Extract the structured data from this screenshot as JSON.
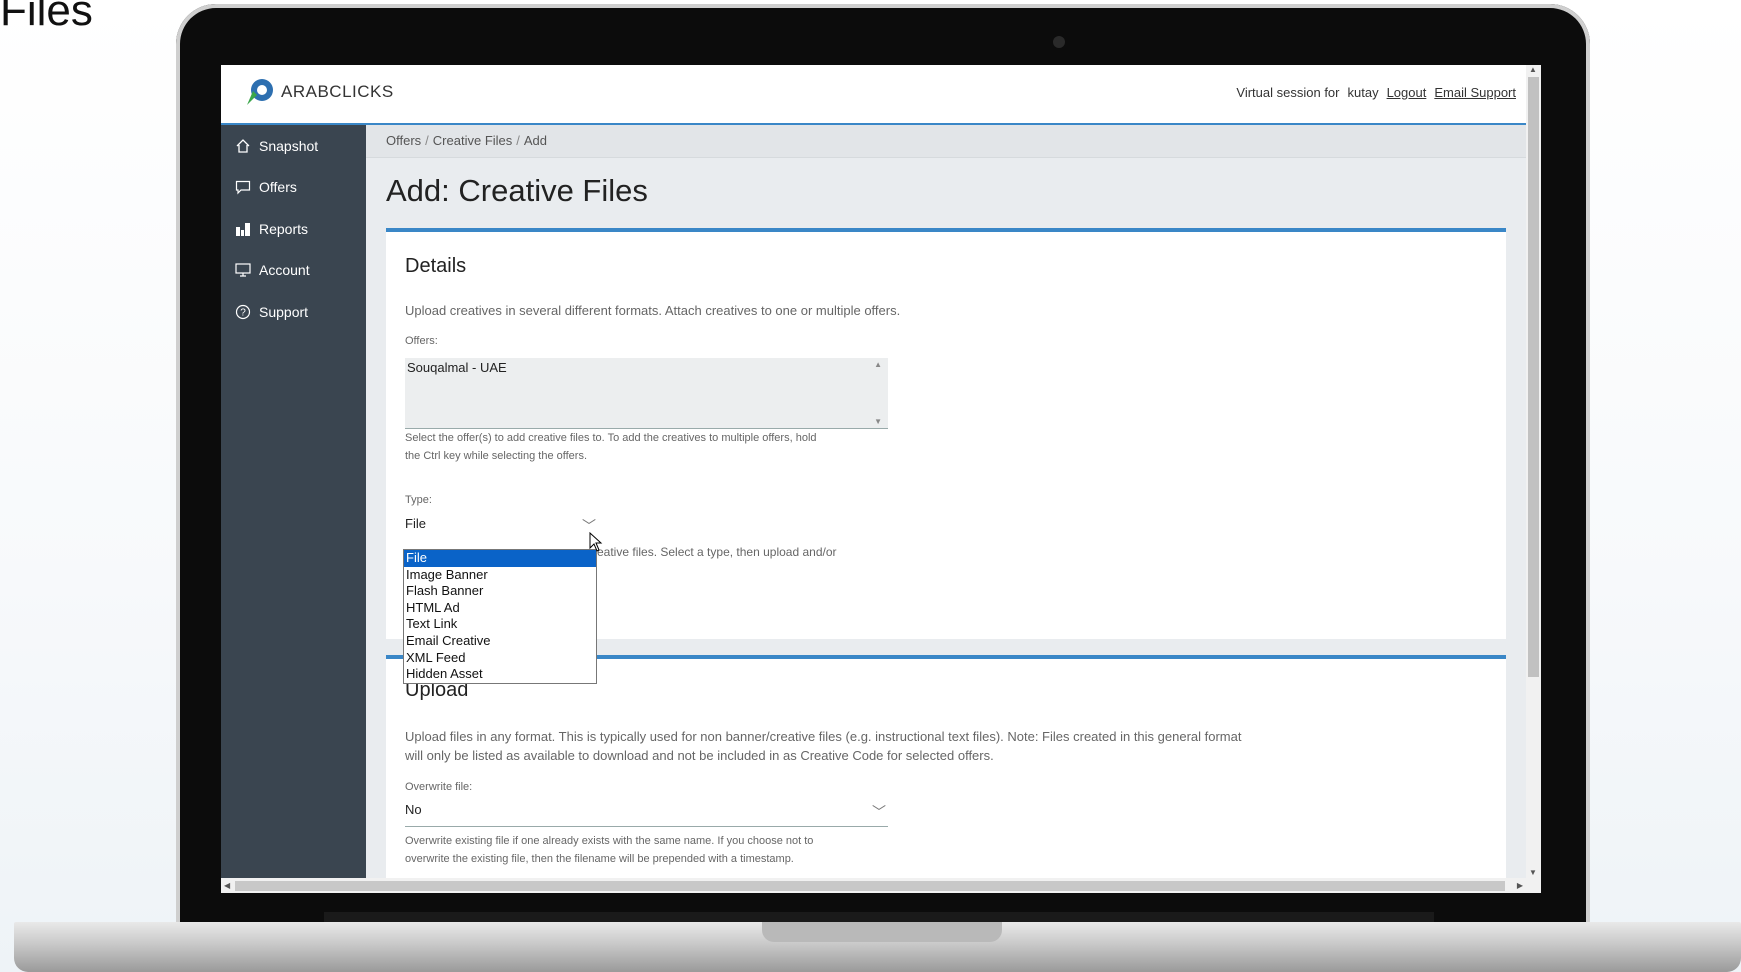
{
  "slide": {
    "title": "Files"
  },
  "app": {
    "logo_text": "ARABCLICKS",
    "header": {
      "session_label": "Virtual session for",
      "user": "kutay",
      "logout": "Logout",
      "email_support": "Email Support"
    },
    "sidebar": {
      "items": [
        {
          "label": "Snapshot",
          "icon": "home-icon"
        },
        {
          "label": "Offers",
          "icon": "chat-bubble-icon"
        },
        {
          "label": "Reports",
          "icon": "bar-chart-icon"
        },
        {
          "label": "Account",
          "icon": "monitor-icon"
        },
        {
          "label": "Support",
          "icon": "question-circle-icon"
        }
      ]
    },
    "breadcrumb": [
      "Offers",
      "Creative Files",
      "Add"
    ],
    "page_title": "Add: Creative Files",
    "details": {
      "heading": "Details",
      "description": "Upload creatives in several different formats. Attach creatives to one or multiple offers.",
      "offers_label": "Offers:",
      "offers_selected": "Souqalmal - UAE",
      "offers_help_1": "Select the offer(s) to add creative files to. To add the creatives to multiple offers, hold",
      "offers_help_2": "the Ctrl key while selecting the offers.",
      "type_label": "Type:",
      "type_value": "File",
      "type_help": "eative files. Select a type, then upload and/or",
      "type_options": [
        "File",
        "Image Banner",
        "Flash Banner",
        "HTML Ad",
        "Text Link",
        "Email Creative",
        "XML Feed",
        "Hidden Asset"
      ],
      "type_selected_index": 0
    },
    "upload": {
      "heading": "Upload",
      "description_1": "Upload files in any format. This is typically used for non banner/creative files (e.g. instructional text files). Note: Files created in this general format",
      "description_2": "will only be listed as available to download and not be included in as Creative Code for selected offers.",
      "overwrite_label": "Overwrite file:",
      "overwrite_value": "No",
      "overwrite_help_1": "Overwrite existing file if one already exists with the same name. If you choose not to",
      "overwrite_help_2": "overwrite the existing file, then the filename will be prepended with a timestamp."
    },
    "colors": {
      "accent": "#3a87c7",
      "sidebar": "#3a4550",
      "selection": "#0a63c8"
    }
  }
}
